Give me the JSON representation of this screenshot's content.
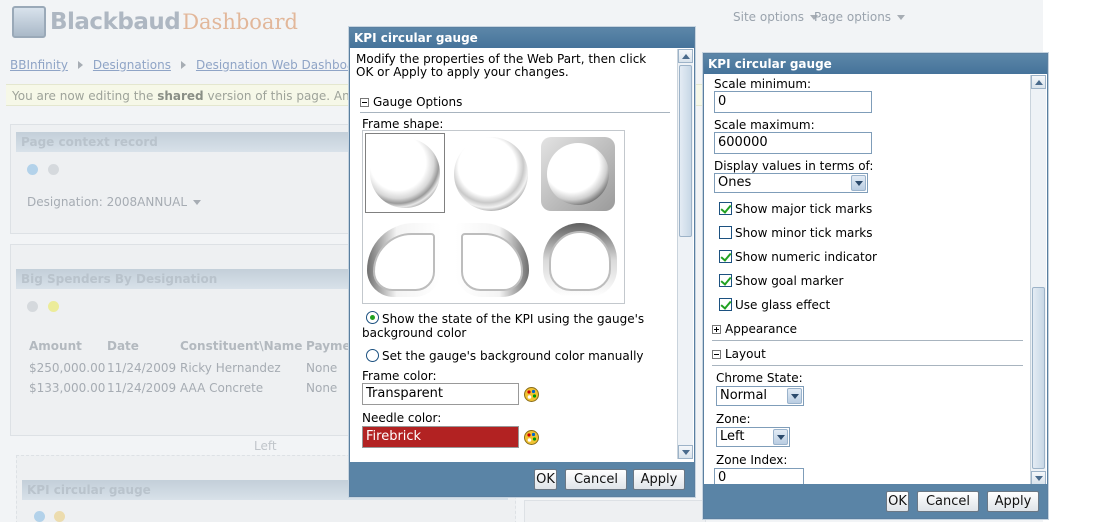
{
  "background": {
    "logo_text": "Blackbaud",
    "logo_sub": "Dashboard",
    "site_options": "Site options",
    "page_options": "Page options",
    "breadcrumb": [
      "BBInfinity",
      "Designations",
      "Designation Web Dashboard"
    ],
    "notice_prefix": "You are now editing the ",
    "notice_bold": "shared",
    "notice_suffix": " version of this page. Any c",
    "part1_title": "Page context record",
    "designation_label": "Designation: 2008ANNUAL",
    "part2_title": "Big Spenders By Designation",
    "table_headers": [
      "Amount",
      "Date",
      "Constituent\\Name",
      "Payme"
    ],
    "table_rows": [
      [
        "$250,000.00",
        "11/24/2009",
        "Ricky Hernandez",
        "None"
      ],
      [
        "$133,000.00",
        "11/24/2009",
        "AAA Concrete",
        "None"
      ]
    ],
    "left_zone_label": "Left",
    "part3_title": "KPI circular gauge"
  },
  "dialog_left": {
    "title": "KPI circular gauge",
    "intro": "Modify the properties of the Web Part, then click OK or Apply to apply your changes.",
    "section_gauge_options": "Gauge Options",
    "frame_shape_label": "Frame shape:",
    "radio_state_label": "Show the state of the KPI using the gauge's background color",
    "radio_manual_label": "Set the gauge's background color manually",
    "frame_color_label": "Frame color:",
    "frame_color_value": "Transparent",
    "needle_color_label": "Needle color:",
    "needle_color_value": "Firebrick",
    "ok_label": "OK",
    "cancel_label": "Cancel",
    "apply_label": "Apply"
  },
  "dialog_right": {
    "title": "KPI circular gauge",
    "scale_min_label": "Scale minimum:",
    "scale_min_value": "0",
    "scale_max_label": "Scale maximum:",
    "scale_max_value": "600000",
    "display_values_label": "Display values in terms of:",
    "display_values_selected": "Ones",
    "checkboxes": [
      {
        "label": "Show major tick marks",
        "checked": true
      },
      {
        "label": "Show minor tick marks",
        "checked": false
      },
      {
        "label": "Show numeric indicator",
        "checked": true
      },
      {
        "label": "Show goal marker",
        "checked": true
      },
      {
        "label": "Use glass effect",
        "checked": true
      }
    ],
    "section_appearance": "Appearance",
    "section_layout": "Layout",
    "chrome_state_label": "Chrome State:",
    "chrome_state_value": "Normal",
    "zone_label": "Zone:",
    "zone_value": "Left",
    "zone_index_label": "Zone Index:",
    "zone_index_value": "0",
    "ok_label": "OK",
    "cancel_label": "Cancel",
    "apply_label": "Apply"
  },
  "colors": {
    "dialog_header": "#4f7ba0",
    "needle_firebrick": "#b22222",
    "check_green": "#21a121"
  }
}
